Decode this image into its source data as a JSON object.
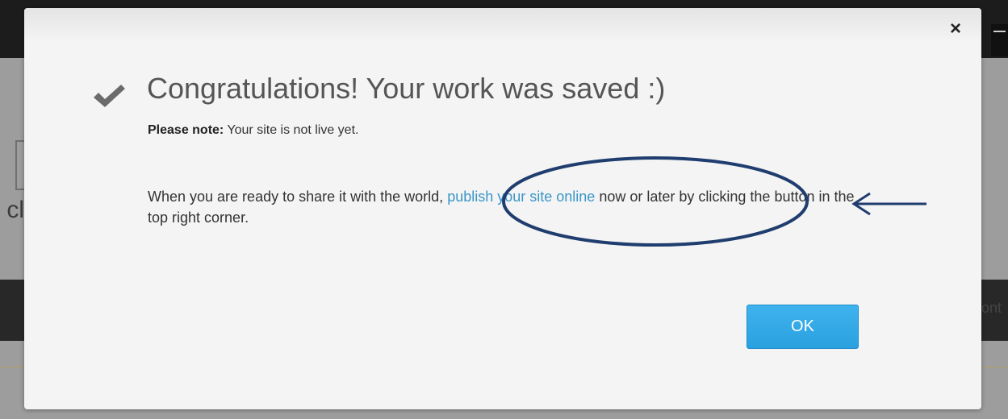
{
  "background": {
    "left_partial_text": "cl",
    "right_partial_text": "ont"
  },
  "modal": {
    "close_label": "×",
    "check_icon": "checkmark-icon",
    "title": "Congratulations! Your work was saved :)",
    "note_label": "Please note:",
    "note_text": "Your site is not live yet.",
    "share_text_before": "When you are ready to share it with the world,",
    "publish_link": "publish your site online",
    "share_text_after": "now or later by clicking the button in the top right corner.",
    "ok_label": "OK"
  },
  "annotation": {
    "color": "#1f3d6e",
    "shapes": [
      "ellipse-highlight",
      "arrow-left"
    ]
  },
  "colors": {
    "link": "#3a96c8",
    "ok_button": "#2aa0df",
    "modal_background": "#f4f4f4",
    "backdrop": "#9d9d9d"
  }
}
